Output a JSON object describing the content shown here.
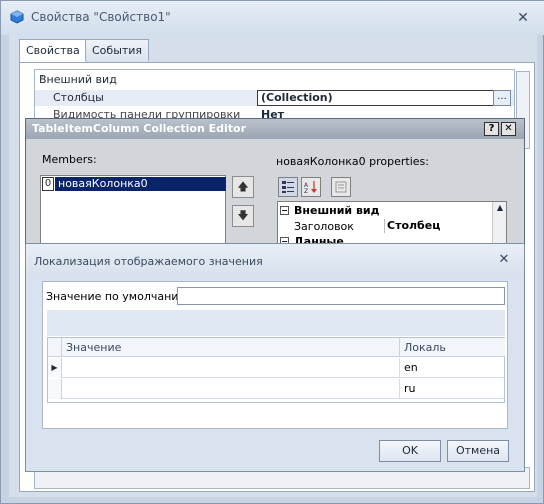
{
  "window": {
    "title": "Свойства \"Свойство1\"",
    "tabs": [
      "Свойства",
      "События"
    ]
  },
  "property_grid": {
    "category": "Внешний вид",
    "rows": [
      {
        "label": "Столбцы",
        "value": "(Collection)"
      },
      {
        "label": "Видимость панели группировки",
        "value": "Нет"
      }
    ],
    "ellipsis": "..."
  },
  "collection_editor": {
    "title": "TableItemColumn Collection Editor",
    "members_label": "Members:",
    "members": [
      {
        "index": "0",
        "name": "новаяКолонка0"
      }
    ],
    "properties_label": "новаяКолонка0 properties:",
    "help_button": "?",
    "close_button": "✕",
    "property_grid": {
      "category1": "Внешний вид",
      "row_label": "Заголовок",
      "row_value": "Столбец",
      "category2": "Данные"
    }
  },
  "localization_dialog": {
    "title": "Локализация отображаемого значения",
    "default_label": "Значение по умолчанию:",
    "default_value": "",
    "table": {
      "columns": [
        "Значение",
        "Локаль"
      ],
      "rows": [
        {
          "value": "",
          "locale": "en"
        },
        {
          "value": "",
          "locale": "ru"
        }
      ]
    },
    "ok_label": "OK",
    "cancel_label": "Отмена"
  }
}
